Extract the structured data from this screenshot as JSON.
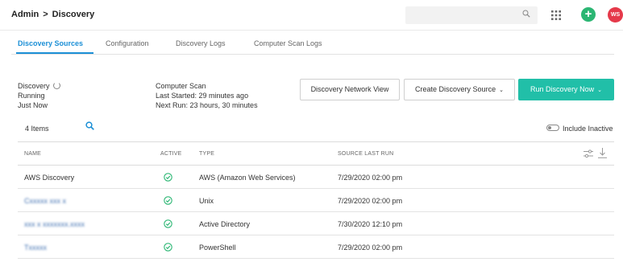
{
  "header": {
    "breadcrumb": [
      "Admin",
      "Discovery"
    ],
    "breadcrumb_separator": ">",
    "search_placeholder": "",
    "avatar_initials": "WS",
    "plus_label": "+"
  },
  "tabs": [
    {
      "label": "Discovery Sources",
      "active": true
    },
    {
      "label": "Configuration",
      "active": false
    },
    {
      "label": "Discovery Logs",
      "active": false
    },
    {
      "label": "Computer Scan Logs",
      "active": false
    }
  ],
  "discovery": {
    "title": "Discovery",
    "status": "Running",
    "time": "Just Now"
  },
  "computer_scan": {
    "title": "Computer Scan",
    "last_started": "Last Started: 29 minutes ago",
    "next_run": "Next Run: 23 hours, 30 minutes"
  },
  "actions": {
    "network_view": "Discovery Network View",
    "create_source": "Create Discovery Source",
    "run_now": "Run Discovery Now"
  },
  "list": {
    "items_count": "4 Items",
    "include_inactive": "Include Inactive"
  },
  "table": {
    "columns": {
      "name": "Name",
      "active": "Active",
      "type": "Type",
      "last_run": "Source Last Run"
    },
    "rows": [
      {
        "name": "AWS Discovery",
        "active": true,
        "type": "AWS (Amazon Web Services)",
        "last_run": "7/29/2020 02:00 pm",
        "name_obscured": false
      },
      {
        "name": "Cxxxxx xxx x",
        "active": true,
        "type": "Unix",
        "last_run": "7/29/2020 02:00 pm",
        "name_obscured": true
      },
      {
        "name": "xxx x xxxxxxx.xxxx",
        "active": true,
        "type": "Active Directory",
        "last_run": "7/30/2020 12:10 pm",
        "name_obscured": true
      },
      {
        "name": "Txxxxx",
        "active": true,
        "type": "PowerShell",
        "last_run": "7/29/2020 02:00 pm",
        "name_obscured": true
      }
    ]
  },
  "colors": {
    "accent": "#1b8fd6",
    "primary_button": "#21bfa8",
    "success": "#2bb673",
    "avatar": "#e5394a"
  }
}
